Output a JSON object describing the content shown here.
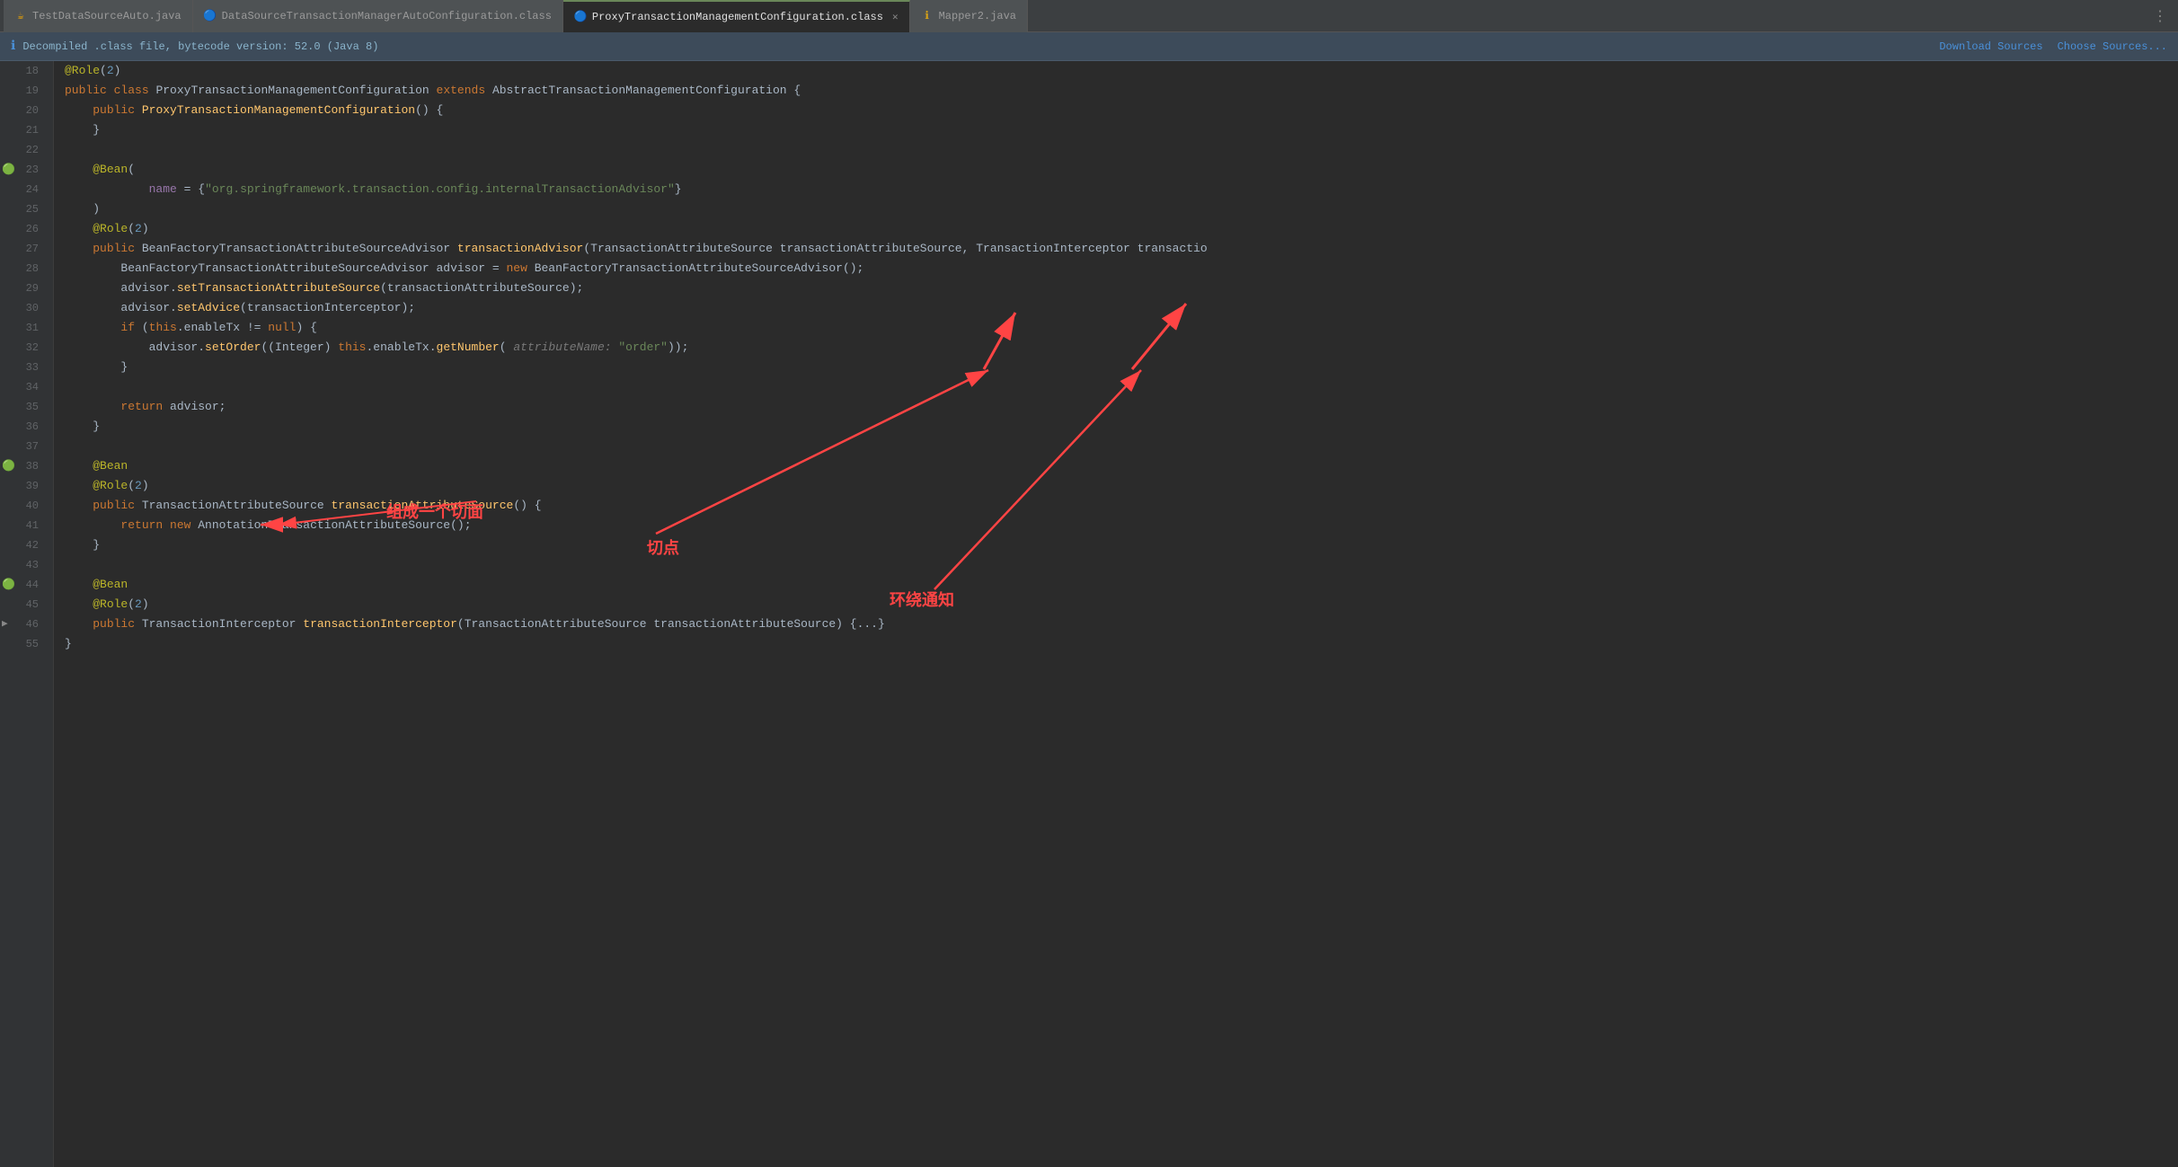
{
  "tabs": [
    {
      "id": "tab1",
      "label": "TestDataSourceAuto.java",
      "icon": "java",
      "active": false,
      "closable": false
    },
    {
      "id": "tab2",
      "label": "DataSourceTransactionManagerAutoConfiguration.class",
      "icon": "class",
      "active": false,
      "closable": false
    },
    {
      "id": "tab3",
      "label": "ProxyTransactionManagementConfiguration.class",
      "icon": "class",
      "active": true,
      "closable": true
    },
    {
      "id": "tab4",
      "label": "Mapper2.java",
      "icon": "info",
      "active": false,
      "closable": false
    }
  ],
  "infobar": {
    "message": "Decompiled .class file, bytecode version: 52.0 (Java 8)",
    "download_sources": "Download Sources",
    "choose_sources": "Choose Sources..."
  },
  "code": {
    "lines": [
      {
        "num": 18,
        "gutter": "",
        "content": "@Role(2)"
      },
      {
        "num": 19,
        "gutter": "",
        "content": "public class ProxyTransactionManagementConfiguration extends AbstractTransactionManagementConfiguration {"
      },
      {
        "num": 20,
        "gutter": "",
        "content": "    public ProxyTransactionManagementConfiguration() {"
      },
      {
        "num": 21,
        "gutter": "",
        "content": "    }"
      },
      {
        "num": 22,
        "gutter": "",
        "content": ""
      },
      {
        "num": 23,
        "gutter": "bean",
        "content": "    @Bean("
      },
      {
        "num": 24,
        "gutter": "",
        "content": "            name = {\"org.springframework.transaction.config.internalTransactionAdvisor\"}"
      },
      {
        "num": 25,
        "gutter": "",
        "content": "    )"
      },
      {
        "num": 26,
        "gutter": "",
        "content": "    @Role(2)"
      },
      {
        "num": 27,
        "gutter": "",
        "content": "    public BeanFactoryTransactionAttributeSourceAdvisor transactionAdvisor(TransactionAttributeSource transactionAttributeSource, TransactionInterceptor transactio"
      },
      {
        "num": 28,
        "gutter": "",
        "content": "        BeanFactoryTransactionAttributeSourceAdvisor advisor = new BeanFactoryTransactionAttributeSourceAdvisor();"
      },
      {
        "num": 29,
        "gutter": "",
        "content": "        advisor.setTransactionAttributeSource(transactionAttributeSource);"
      },
      {
        "num": 30,
        "gutter": "",
        "content": "        advisor.setAdvice(transactionInterceptor);"
      },
      {
        "num": 31,
        "gutter": "",
        "content": "        if (this.enableTx != null) {"
      },
      {
        "num": 32,
        "gutter": "",
        "content": "            advisor.setOrder((Integer) this.enableTx.getNumber( attributeName: \"order\"));"
      },
      {
        "num": 33,
        "gutter": "",
        "content": "        }"
      },
      {
        "num": 34,
        "gutter": "",
        "content": ""
      },
      {
        "num": 35,
        "gutter": "",
        "content": "        return advisor;"
      },
      {
        "num": 36,
        "gutter": "",
        "content": "    }"
      },
      {
        "num": 37,
        "gutter": "",
        "content": ""
      },
      {
        "num": 38,
        "gutter": "bean",
        "content": "    @Bean"
      },
      {
        "num": 39,
        "gutter": "",
        "content": "    @Role(2)"
      },
      {
        "num": 40,
        "gutter": "",
        "content": "    public TransactionAttributeSource transactionAttributeSource() {"
      },
      {
        "num": 41,
        "gutter": "",
        "content": "        return new AnnotationTransactionAttributeSource();"
      },
      {
        "num": 42,
        "gutter": "",
        "content": "    }"
      },
      {
        "num": 43,
        "gutter": "",
        "content": ""
      },
      {
        "num": 44,
        "gutter": "bean",
        "content": "    @Bean"
      },
      {
        "num": 45,
        "gutter": "",
        "content": "    @Role(2)"
      },
      {
        "num": 46,
        "gutter": "",
        "content": "    public TransactionInterceptor transactionInterceptor(TransactionAttributeSource transactionAttributeSource) {...}"
      },
      {
        "num": 55,
        "gutter": "",
        "content": "}"
      }
    ]
  },
  "annotations": {
    "label1": "组成一个切面",
    "label2": "切点",
    "label3": "环绕通知"
  }
}
